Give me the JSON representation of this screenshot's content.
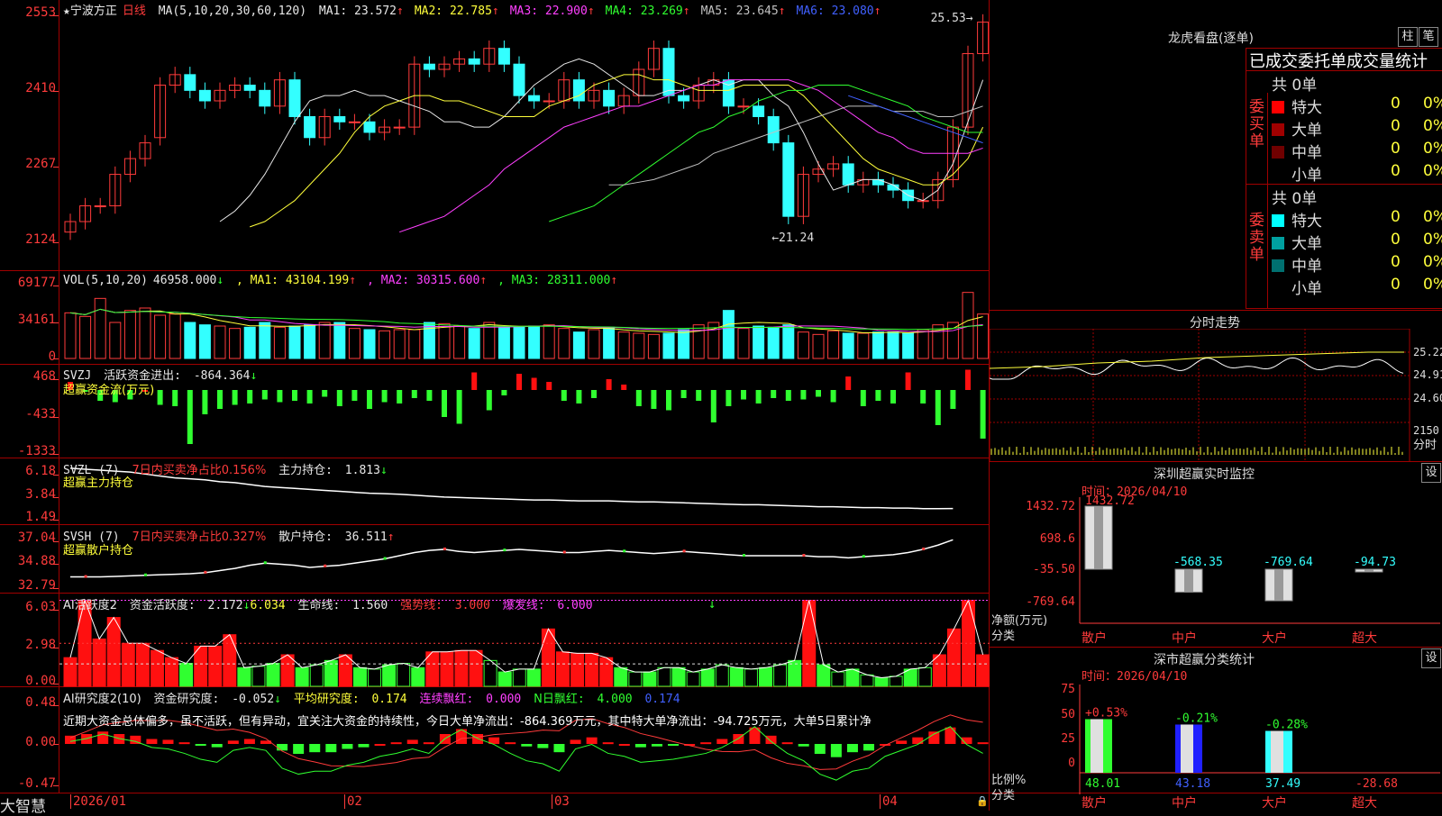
{
  "stock": {
    "marker": "★",
    "name": "宁波方正",
    "period": "日线"
  },
  "kline": {
    "ma_label": "MA(5,10,20,30,60,120)",
    "mas": [
      {
        "name": "MA1",
        "value": "23.572",
        "arrow": "↑",
        "color": "#e8e8e8"
      },
      {
        "name": "MA2",
        "value": "22.785",
        "arrow": "↑",
        "color": "#ffff3b"
      },
      {
        "name": "MA3",
        "value": "22.900",
        "arrow": "↑",
        "color": "#ff40ff"
      },
      {
        "name": "MA4",
        "value": "23.269",
        "arrow": "↑",
        "color": "#30ff30"
      },
      {
        "name": "MA5",
        "value": "23.645",
        "arrow": "↑",
        "color": "#c0c0c0"
      },
      {
        "name": "MA6",
        "value": "23.080",
        "arrow": "↑",
        "color": "#4060ff"
      }
    ],
    "y_ticks": [
      "2553",
      "2410",
      "2267",
      "2124"
    ],
    "high_mark": "25.53",
    "low_mark": "21.24",
    "closes": [
      21.6,
      21.9,
      21.9,
      22.5,
      22.8,
      23.1,
      24.2,
      24.4,
      24.1,
      23.9,
      24.1,
      24.2,
      24.1,
      23.8,
      24.3,
      23.6,
      23.2,
      23.6,
      23.5,
      23.5,
      23.3,
      23.4,
      23.4,
      24.6,
      24.5,
      24.6,
      24.7,
      24.6,
      24.9,
      24.6,
      24.0,
      23.9,
      23.9,
      24.3,
      23.9,
      24.1,
      23.8,
      24.0,
      24.5,
      24.9,
      24.0,
      23.9,
      24.2,
      24.3,
      23.8,
      23.8,
      23.6,
      23.1,
      21.7,
      22.5,
      22.6,
      22.7,
      22.3,
      22.4,
      22.3,
      22.2,
      22.0,
      22.0,
      22.4,
      23.4,
      24.8,
      25.4
    ],
    "opens": [
      21.4,
      21.6,
      21.9,
      21.9,
      22.5,
      22.8,
      23.2,
      24.2,
      24.4,
      24.1,
      23.9,
      24.1,
      24.2,
      24.1,
      23.8,
      24.3,
      23.6,
      23.2,
      23.6,
      23.5,
      23.5,
      23.3,
      23.4,
      23.4,
      24.6,
      24.5,
      24.6,
      24.7,
      24.6,
      24.9,
      24.6,
      24.0,
      23.9,
      23.9,
      24.3,
      23.9,
      24.1,
      23.8,
      24.0,
      24.5,
      24.9,
      24.0,
      23.9,
      24.2,
      24.3,
      23.8,
      23.8,
      23.6,
      23.1,
      21.7,
      22.5,
      22.6,
      22.7,
      22.3,
      22.4,
      22.3,
      22.2,
      22.0,
      22.0,
      22.4,
      23.4,
      24.8
    ],
    "ma_lines": {
      "ma1": [
        21.6,
        21.8,
        22.1,
        22.5,
        23.0,
        23.5,
        23.9,
        24.0,
        24.0,
        24.1,
        24.0,
        24.0,
        23.9,
        23.8,
        23.7,
        23.5,
        23.5,
        23.4,
        23.4,
        23.6,
        23.9,
        24.2,
        24.4,
        24.6,
        24.7,
        24.6,
        24.4,
        24.2,
        24.0,
        24.0,
        24.1,
        24.1,
        24.2,
        24.3,
        24.2,
        24.3,
        24.3,
        24.0,
        23.8,
        23.3,
        22.7,
        22.2,
        22.3,
        22.4,
        22.4,
        22.3,
        22.1,
        22.0,
        22.2,
        22.7,
        23.5,
        24.3
      ],
      "ma2": [
        21.5,
        21.6,
        21.8,
        22.0,
        22.3,
        22.6,
        22.9,
        23.3,
        23.6,
        23.8,
        23.9,
        24.0,
        24.0,
        23.9,
        23.9,
        23.8,
        23.7,
        23.6,
        23.6,
        23.6,
        23.8,
        23.9,
        24.0,
        24.2,
        24.3,
        24.4,
        24.4,
        24.3,
        24.3,
        24.2,
        24.1,
        24.1,
        24.1,
        24.2,
        24.2,
        24.2,
        24.2,
        24.0,
        23.7,
        23.4,
        23.1,
        22.8,
        22.6,
        22.5,
        22.4,
        22.3,
        22.3,
        22.5,
        22.8,
        23.4
      ],
      "ma3": [
        21.4,
        21.5,
        21.6,
        21.7,
        21.9,
        22.1,
        22.3,
        22.6,
        22.8,
        23.0,
        23.2,
        23.4,
        23.5,
        23.6,
        23.7,
        23.8,
        23.8,
        23.9,
        24.0,
        24.1,
        24.2,
        24.2,
        24.3,
        24.3,
        24.3,
        24.3,
        24.3,
        24.2,
        24.1,
        23.9,
        23.7,
        23.5,
        23.3,
        23.2,
        23.0,
        22.9,
        22.9,
        22.9,
        22.9,
        23.0
      ],
      "ma4": [
        21.6,
        21.7,
        21.8,
        21.9,
        22.1,
        22.3,
        22.5,
        22.7,
        22.9,
        23.1,
        23.3,
        23.4,
        23.6,
        23.7,
        23.9,
        24.0,
        24.1,
        24.1,
        24.2,
        24.2,
        24.2,
        24.1,
        24.0,
        23.9,
        23.8,
        23.6,
        23.5,
        23.4,
        23.3,
        23.3
      ],
      "ma5": [
        22.3,
        22.3,
        22.35,
        22.4,
        22.5,
        22.6,
        22.7,
        22.9,
        23.0,
        23.1,
        23.2,
        23.3,
        23.4,
        23.5,
        23.6,
        23.7,
        23.8,
        23.8,
        23.8,
        23.7,
        23.7,
        23.7,
        23.6,
        23.6,
        23.7,
        23.8
      ],
      "ma6": [
        24.0,
        23.9,
        23.8,
        23.7,
        23.6,
        23.5,
        23.4,
        23.3,
        23.2,
        23.1
      ]
    }
  },
  "vol": {
    "label": "VOL(5,10,20)",
    "value": "46958.000",
    "arrow": "↓",
    "mas": [
      {
        "name": "MA1",
        "value": "43104.199",
        "arrow": "↑",
        "color": "#ffff3b"
      },
      {
        "name": "MA2",
        "value": "30315.600",
        "arrow": "↑",
        "color": "#ff40ff"
      },
      {
        "name": "MA3",
        "value": "28311.000",
        "arrow": "↑",
        "color": "#30ff30"
      }
    ],
    "y_ticks": [
      "69177",
      "34161",
      "0"
    ],
    "bars": [
      38,
      35,
      50,
      30,
      40,
      42,
      36,
      37,
      30,
      28,
      27,
      25,
      26,
      30,
      26,
      27,
      28,
      30,
      30,
      25,
      24,
      23,
      24,
      24,
      30,
      29,
      27,
      25,
      30,
      26,
      26,
      27,
      28,
      25,
      22,
      24,
      26,
      22,
      21,
      20,
      21,
      24,
      28,
      30,
      40,
      25,
      27,
      26,
      28,
      22,
      20,
      23,
      21,
      21,
      22,
      22,
      21,
      24,
      28,
      30,
      55,
      37
    ]
  },
  "svzj": {
    "label": "SVZJ",
    "title": "活跃资金进出",
    "value": "-864.364",
    "arrow": "↓",
    "sub": "超赢资金流(万元)",
    "y_ticks": [
      "468",
      "-433",
      "-1333"
    ],
    "bars": [
      60,
      -10,
      -80,
      -90,
      -70,
      0,
      -110,
      -120,
      -400,
      -180,
      -140,
      -110,
      -100,
      -70,
      -90,
      -80,
      -100,
      -50,
      -120,
      -80,
      -140,
      -90,
      -100,
      -60,
      -80,
      -200,
      -250,
      130,
      -150,
      -40,
      120,
      90,
      60,
      -80,
      -100,
      -60,
      80,
      40,
      -120,
      -140,
      -150,
      -60,
      -80,
      -240,
      -120,
      -70,
      -100,
      -60,
      -80,
      -70,
      -50,
      -90,
      100,
      -120,
      -80,
      -100,
      130,
      -100,
      -260,
      -140,
      150,
      -360
    ]
  },
  "svzl": {
    "label": "SVZL (7)",
    "title": "7日内买卖净占比0.156%",
    "hold_label": "主力持仓",
    "hold_value": "1.813",
    "arrow": "↓",
    "sub": "超赢主力持仓",
    "y_ticks": [
      "6.18",
      "3.84",
      "1.49"
    ],
    "line": [
      6.0,
      5.9,
      5.8,
      5.7,
      5.6,
      5.4,
      5.2,
      5.0,
      4.9,
      4.8,
      4.6,
      4.5,
      4.3,
      4.1,
      4.0,
      3.9,
      3.8,
      3.7,
      3.6,
      3.5,
      3.4,
      3.35,
      3.3,
      3.2,
      3.1,
      3.0,
      2.95,
      2.9,
      2.85,
      2.8,
      2.75,
      2.7,
      2.7,
      2.65,
      2.6,
      2.6,
      2.6,
      2.55,
      2.5,
      2.5,
      2.45,
      2.4,
      2.35,
      2.3,
      2.25,
      2.2,
      2.2,
      2.15,
      2.1,
      2.05,
      2.0,
      2.0,
      1.95,
      1.9,
      1.9,
      1.85,
      1.85,
      1.8,
      1.8,
      1.81
    ]
  },
  "svsh": {
    "label": "SVSH (7)",
    "title": "7日内买卖净占比0.327%",
    "hold_label": "散户持仓",
    "hold_value": "36.511",
    "arrow": "↑",
    "sub": "超赢散户持仓",
    "y_ticks": [
      "37.04",
      "34.88",
      "32.79"
    ],
    "line": [
      33.0,
      33.0,
      33.0,
      33.05,
      33.1,
      33.15,
      33.2,
      33.25,
      33.3,
      33.4,
      33.6,
      33.8,
      34.1,
      34.3,
      34.2,
      34.1,
      33.9,
      34.0,
      34.1,
      34.3,
      34.5,
      34.7,
      35.0,
      35.3,
      35.5,
      35.6,
      35.4,
      35.3,
      35.4,
      35.5,
      35.6,
      35.5,
      35.4,
      35.3,
      35.3,
      35.4,
      35.5,
      35.4,
      35.3,
      35.2,
      35.3,
      35.4,
      35.3,
      35.2,
      35.1,
      35.0,
      35.0,
      35.0,
      35.0,
      35.0,
      34.9,
      34.9,
      34.8,
      34.9,
      35.0,
      35.1,
      35.3,
      35.6,
      36.0,
      36.5
    ]
  },
  "ai1": {
    "label": "AI活跃度2",
    "title": "资金活跃度",
    "value": "2.172",
    "arrow": "↓",
    "v2": "6.034",
    "life_label": "生命线",
    "life_value": "1.560",
    "strong_label": "强势线",
    "strong_value": "3.000",
    "burst_label": "爆发线",
    "burst_value": "6.000",
    "y_ticks": [
      "6.03",
      "2.98",
      "0.00"
    ],
    "bars": [
      2.0,
      6.0,
      3.3,
      4.8,
      3.0,
      3.0,
      2.5,
      2.0,
      1.6,
      2.8,
      2.8,
      3.6,
      1.3,
      1.4,
      1.6,
      2.2,
      1.3,
      1.5,
      1.8,
      2.2,
      1.3,
      1.2,
      1.5,
      1.6,
      1.3,
      2.4,
      2.4,
      2.5,
      2.5,
      1.8,
      1.0,
      1.2,
      1.2,
      4.0,
      2.4,
      2.3,
      2.3,
      2.0,
      1.3,
      1.0,
      1.0,
      1.3,
      1.3,
      1.0,
      1.2,
      1.5,
      1.3,
      1.2,
      1.3,
      1.5,
      1.8,
      6.0,
      1.5,
      1.0,
      1.2,
      0.8,
      0.6,
      0.7,
      1.2,
      1.3,
      2.2,
      4.0,
      6.0,
      2.2
    ]
  },
  "ai2": {
    "label": "AI研究度2(10)",
    "title": "资金研究度",
    "value": "-0.052",
    "arrow": "↓",
    "avg_label": "平均研究度",
    "avg_value": "0.174",
    "cont_label": "连续飘红",
    "cont_value": "0.000",
    "n_label": "N日飘红",
    "n_value": "4.000",
    "n2_value": "0.174",
    "y_ticks": [
      "0.48",
      "0.00",
      "-0.47"
    ],
    "comment": "近期大资金总体偏多，虽不活跃，但有异动，宜关注大资金的持续性，今日大单净流出：-864.369万元，其中特大单净流出：-94.725万元，大单5日累计净"
  },
  "date_axis": [
    "2026/01",
    "02",
    "03",
    "04"
  ],
  "logo": "大智慧",
  "lhb": {
    "title": "龙虎看盘(逐单)",
    "btn1": "柱",
    "btn2": "笔",
    "tabs": [
      "已成交",
      "委托单",
      "成交量统计"
    ],
    "buy_side": "委买单",
    "sell_side": "委卖单",
    "buy_total": "共 0单",
    "sell_total": "共 0单",
    "rows": [
      {
        "name": "特大",
        "count": "0",
        "pct": "0%"
      },
      {
        "name": "大单",
        "count": "0",
        "pct": "0%"
      },
      {
        "name": "中单",
        "count": "0",
        "pct": "0%"
      },
      {
        "name": "小单",
        "count": "0",
        "pct": "0%"
      }
    ],
    "buy_colors": [
      "#ff0000",
      "#a00000",
      "#700000",
      ""
    ],
    "sell_colors": [
      "#00ffff",
      "#00a0a0",
      "#007070",
      ""
    ]
  },
  "intraday": {
    "title": "分时走势",
    "prices": [
      "25.22",
      "24.91",
      "24.60"
    ],
    "vol": "2150",
    "fenshi": "分时"
  },
  "monitor": {
    "title": "深圳超赢实时监控",
    "settings": "设",
    "time_label": "时间：2026/04/10",
    "y_ticks": [
      "1432.72",
      "698.6",
      "-35.50",
      "-769.64"
    ],
    "bars": [
      {
        "cat": "散户",
        "value": "1432.72"
      },
      {
        "cat": "中户",
        "value": "-568.35"
      },
      {
        "cat": "大户",
        "value": "-769.64"
      },
      {
        "cat": "超大",
        "value": "-94.73"
      }
    ],
    "ylabel1": "净额(万元)",
    "ylabel2": "分类"
  },
  "classify": {
    "title": "深市超赢分类统计",
    "settings": "设",
    "time_label": "时间：2026/04/10",
    "y_ticks": [
      "75",
      "50",
      "25",
      "0"
    ],
    "bars": [
      {
        "cat": "散户",
        "pct": "+0.53%",
        "value": "48.01"
      },
      {
        "cat": "中户",
        "pct": "-0.21%",
        "value": "43.18"
      },
      {
        "cat": "大户",
        "pct": "-0.28%",
        "value": "37.49"
      },
      {
        "cat": "超大",
        "pct": "",
        "value": "-28.68"
      }
    ],
    "ylabel1": "比例%",
    "ylabel2": "分类"
  }
}
